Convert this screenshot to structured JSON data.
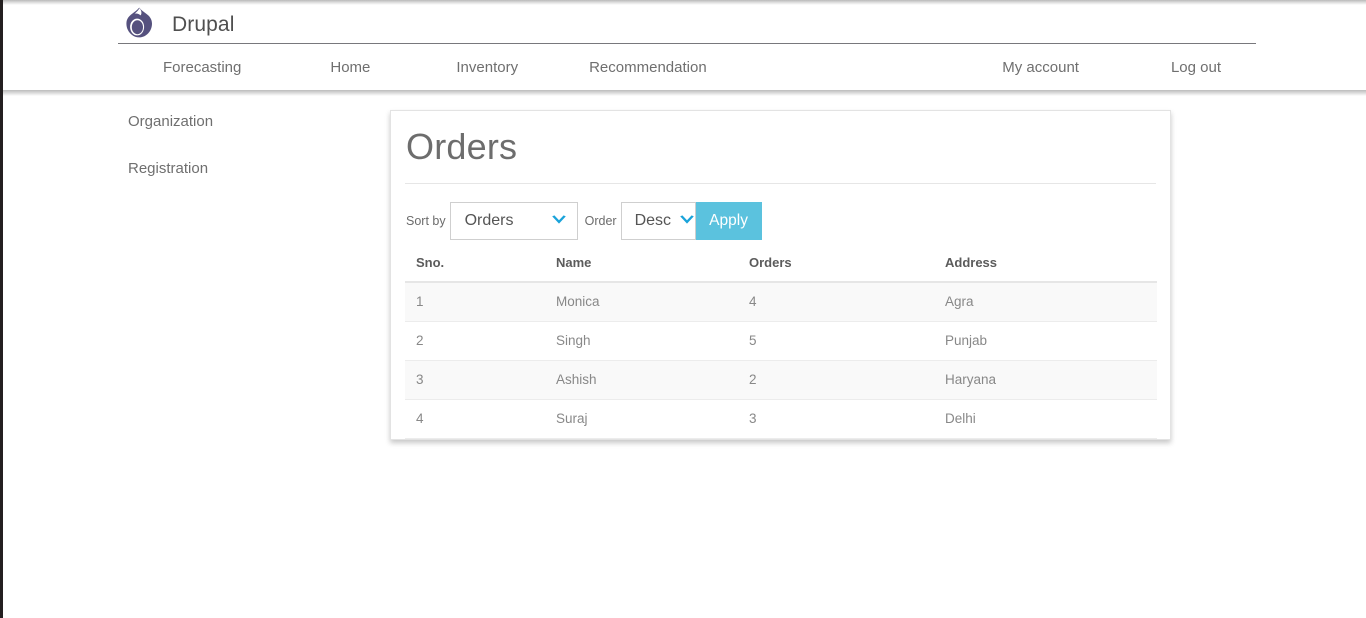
{
  "brand": {
    "name": "Drupal",
    "logo_icon": "drupal-droplet-icon",
    "logo_color": "#55517e"
  },
  "nav": {
    "primary": [
      {
        "label": "Forecasting"
      },
      {
        "label": "Home"
      },
      {
        "label": "Inventory"
      },
      {
        "label": "Recommendation"
      }
    ],
    "secondary": [
      {
        "label": "My account"
      },
      {
        "label": "Log out"
      }
    ]
  },
  "sidebar": {
    "items": [
      {
        "label": "Organization"
      },
      {
        "label": "Registration"
      }
    ]
  },
  "main": {
    "title": "Orders",
    "controls": {
      "sort_by_label": "Sort by",
      "sort_by_value": "Orders",
      "sort_by_options": [
        "Orders"
      ],
      "order_label": "Order",
      "order_value": "Desc",
      "order_options": [
        "Desc"
      ],
      "apply_label": "Apply",
      "chevron_icon": "chevron-down-icon",
      "chevron_color": "#1aa3da",
      "apply_color": "#5bc2de"
    },
    "table": {
      "columns": [
        "Sno.",
        "Name",
        "Orders",
        "Address"
      ],
      "rows": [
        {
          "sno": "1",
          "name": "Monica",
          "orders": "4",
          "address": "Agra"
        },
        {
          "sno": "2",
          "name": "Singh",
          "orders": "5",
          "address": "Punjab"
        },
        {
          "sno": "3",
          "name": "Ashish",
          "orders": "2",
          "address": "Haryana"
        },
        {
          "sno": "4",
          "name": "Suraj",
          "orders": "3",
          "address": "Delhi"
        }
      ]
    }
  }
}
